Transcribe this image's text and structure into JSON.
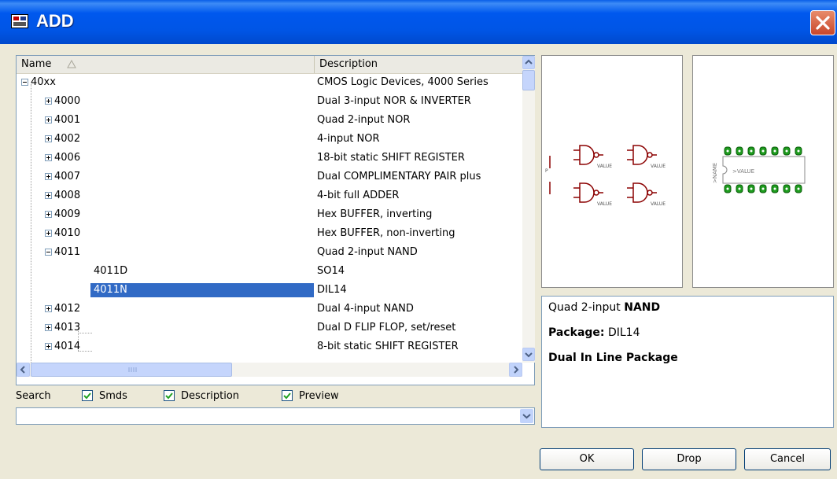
{
  "window": {
    "title": "ADD"
  },
  "tree": {
    "columns": {
      "name": "Name",
      "description": "Description"
    },
    "rows": [
      {
        "name": "40xx",
        "desc": "CMOS Logic Devices, 4000 Series"
      },
      {
        "name": "4000",
        "desc": "Dual 3-input NOR & INVERTER"
      },
      {
        "name": "4001",
        "desc": "Quad 2-input NOR"
      },
      {
        "name": "4002",
        "desc": "4-input NOR"
      },
      {
        "name": "4006",
        "desc": "18-bit static SHIFT REGISTER"
      },
      {
        "name": "4007",
        "desc": "Dual COMPLIMENTARY PAIR plus"
      },
      {
        "name": "4008",
        "desc": "4-bit full ADDER"
      },
      {
        "name": "4009",
        "desc": "Hex BUFFER, inverting"
      },
      {
        "name": "4010",
        "desc": "Hex BUFFER, non-inverting"
      },
      {
        "name": "4011",
        "desc": "Quad 2-input NAND"
      },
      {
        "name": "4011D",
        "desc": "SO14"
      },
      {
        "name": "4011N",
        "desc": "DIL14"
      },
      {
        "name": "4012",
        "desc": "Dual 4-input NAND"
      },
      {
        "name": "4013",
        "desc": "Dual D FLIP FLOP, set/reset"
      },
      {
        "name": "4014",
        "desc": "8-bit static SHIFT REGISTER"
      }
    ]
  },
  "search": {
    "label": "Search",
    "smds": "Smds",
    "description": "Description",
    "preview": "Preview",
    "value": ""
  },
  "symbol_preview": {
    "gate_value_label": "VALUE",
    "pin_label": "P"
  },
  "package_preview": {
    "name_label": ">NAME",
    "value_label": ">VALUE"
  },
  "info": {
    "line1_prefix": "Quad 2-input ",
    "line1_bold": "NAND",
    "package_label": "Package:",
    "package_value": " DIL14",
    "package_desc": "Dual In Line Package"
  },
  "buttons": {
    "ok": "OK",
    "drop": "Drop",
    "cancel": "Cancel"
  },
  "colors": {
    "titlebar": "#0055E5",
    "selection": "#316AC5",
    "board_green": "#1E9B1E",
    "symbol_red": "#8B0000"
  }
}
